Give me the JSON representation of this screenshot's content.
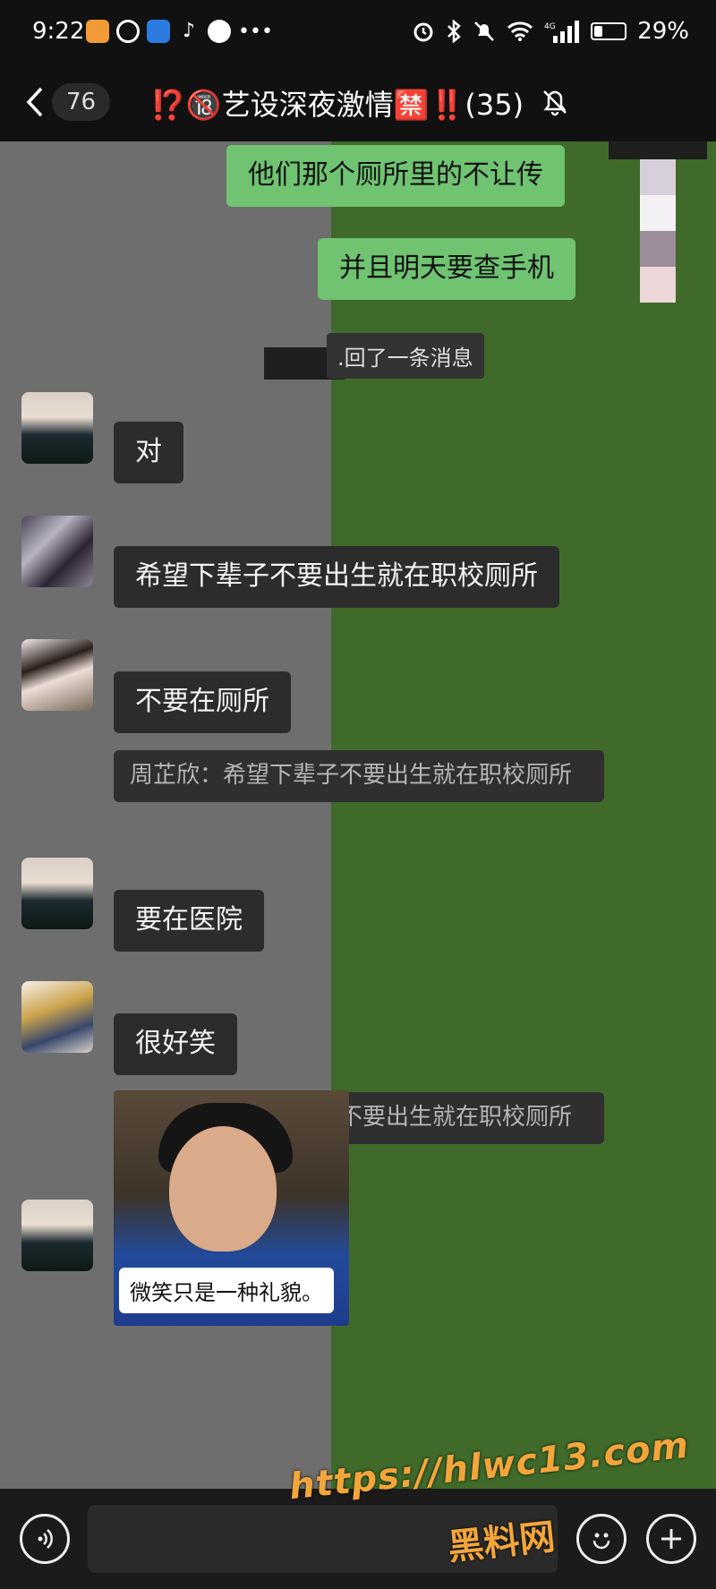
{
  "status_bar": {
    "time": "9:22",
    "battery_pct": "29%",
    "battery_level": 0.29
  },
  "nav": {
    "back_count": "76",
    "title": "⁉️🔞艺设深夜激情🈲‼️(35)"
  },
  "messages": {
    "me1": "他们那个厕所里的不让传",
    "me2": "并且明天要查手机",
    "system": ".回了一条消息",
    "m1": "对",
    "m2": "希望下辈子不要出生就在职校厕所",
    "m3": "不要在厕所",
    "quote1": "周芷欣：希望下辈子不要出生就在职校厕所",
    "m4": "要在医院",
    "m5": "很好笑",
    "quote2": "周芷欣：希望下辈子不要出生就在职校厕所",
    "photo_caption": "微笑只是一种礼貌。"
  },
  "watermark": {
    "url": "https://hlwc13.com",
    "site": "黑料网"
  },
  "colors": {
    "my_bubble": "#6fc371",
    "other_bubble": "#2c2c2c",
    "chat_bg": "#6e6e6e",
    "green": "#3f6a2a"
  },
  "icons": [
    "back-chevron-icon",
    "mute-bell-icon",
    "voice-icon",
    "emoji-icon",
    "plus-icon",
    "alarm-icon",
    "bluetooth-icon",
    "dnd-icon",
    "wifi-icon",
    "signal-icon",
    "battery-icon"
  ]
}
